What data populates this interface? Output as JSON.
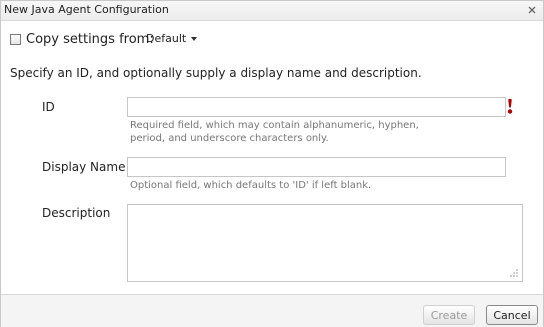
{
  "dialog": {
    "title": "New Java Agent Configuration"
  },
  "copy_settings": {
    "label": "Copy settings from:",
    "checked": false,
    "selected": "Default"
  },
  "instructions": "Specify an ID, and optionally supply a display name and description.",
  "fields": {
    "id": {
      "label": "ID",
      "value": "",
      "hint_line1": "Required field, which may contain alphanumeric, hyphen,",
      "hint_line2": "period, and underscore characters only."
    },
    "display_name": {
      "label": "Display Name",
      "value": "",
      "hint": "Optional field, which defaults to 'ID' if left blank."
    },
    "description": {
      "label": "Description",
      "value": ""
    }
  },
  "buttons": {
    "create": "Create",
    "cancel": "Cancel"
  },
  "colors": {
    "required": "#b40000",
    "hint_text": "#777777",
    "border": "#c6c6c6"
  }
}
